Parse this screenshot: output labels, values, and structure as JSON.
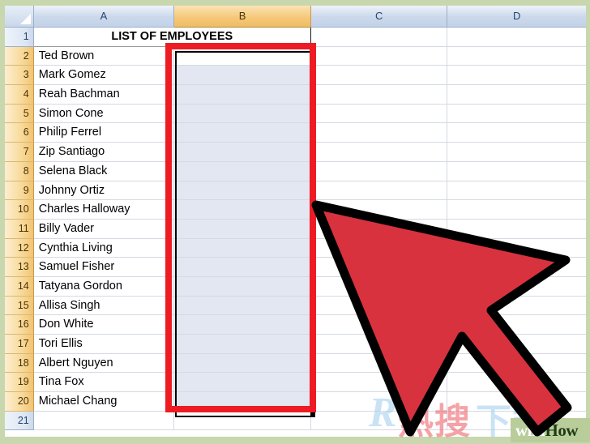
{
  "app": {
    "type": "spreadsheet",
    "background_color": "#c8d7ae"
  },
  "grid": {
    "columns": [
      {
        "label": "A",
        "selected": false
      },
      {
        "label": "B",
        "selected": true
      },
      {
        "label": "C",
        "selected": false
      },
      {
        "label": "D",
        "selected": false
      }
    ],
    "corner_select_all": "select-all",
    "title_cell": {
      "row": "1",
      "text": "LIST OF EMPLOYEES",
      "merged_range": "A1:B1",
      "bold": true,
      "align": "center"
    },
    "rows": [
      {
        "number": "1",
        "name": "",
        "header_selected": false,
        "cell_selected": false
      },
      {
        "number": "2",
        "name": "Ted Brown",
        "header_selected": true,
        "cell_selected": false
      },
      {
        "number": "3",
        "name": "Mark Gomez",
        "header_selected": true,
        "cell_selected": true
      },
      {
        "number": "4",
        "name": "Reah Bachman",
        "header_selected": true,
        "cell_selected": true
      },
      {
        "number": "5",
        "name": "Simon Cone",
        "header_selected": true,
        "cell_selected": true
      },
      {
        "number": "6",
        "name": "Philip Ferrel",
        "header_selected": true,
        "cell_selected": true
      },
      {
        "number": "7",
        "name": "Zip Santiago",
        "header_selected": true,
        "cell_selected": true
      },
      {
        "number": "8",
        "name": "Selena Black",
        "header_selected": true,
        "cell_selected": true
      },
      {
        "number": "9",
        "name": "Johnny Ortiz",
        "header_selected": true,
        "cell_selected": true
      },
      {
        "number": "10",
        "name": "Charles Halloway",
        "header_selected": true,
        "cell_selected": true
      },
      {
        "number": "11",
        "name": "Billy Vader",
        "header_selected": true,
        "cell_selected": true
      },
      {
        "number": "12",
        "name": "Cynthia Living",
        "header_selected": true,
        "cell_selected": true
      },
      {
        "number": "13",
        "name": "Samuel Fisher",
        "header_selected": true,
        "cell_selected": true
      },
      {
        "number": "14",
        "name": "Tatyana Gordon",
        "header_selected": true,
        "cell_selected": true
      },
      {
        "number": "15",
        "name": "Allisa Singh",
        "header_selected": true,
        "cell_selected": true
      },
      {
        "number": "16",
        "name": "Don White",
        "header_selected": true,
        "cell_selected": true
      },
      {
        "number": "17",
        "name": "Tori Ellis",
        "header_selected": true,
        "cell_selected": true
      },
      {
        "number": "18",
        "name": "Albert Nguyen",
        "header_selected": true,
        "cell_selected": true
      },
      {
        "number": "19",
        "name": "Tina Fox",
        "header_selected": true,
        "cell_selected": true
      },
      {
        "number": "20",
        "name": "Michael Chang",
        "header_selected": true,
        "cell_selected": true
      },
      {
        "number": "21",
        "name": "",
        "header_selected": false,
        "cell_selected": false
      }
    ],
    "selection": {
      "range": "B2:B20",
      "active_cell": "B2",
      "highlight_color": "#e3e7f1",
      "header_highlight_color": "#f5c97a"
    }
  },
  "annotation": {
    "type": "rectangle-callout",
    "color": "#ed1c24",
    "target": "column-b-selection"
  },
  "cursor": {
    "type": "arrow-pointer",
    "color": "#d32f3c",
    "outline_color": "#000000"
  },
  "watermarks": {
    "chinese": {
      "letter": "R",
      "red_text": "热搜",
      "blue_text": "下载"
    },
    "wikihow": {
      "part1": "wiki",
      "part2": "How"
    }
  }
}
